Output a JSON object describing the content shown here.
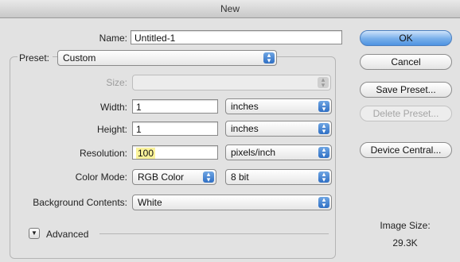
{
  "dialog": {
    "title": "New"
  },
  "form": {
    "name_label": "Name:",
    "name_value": "Untitled-1",
    "preset_label": "Preset:",
    "preset_value": "Custom",
    "size_label": "Size:",
    "size_value": "",
    "width_label": "Width:",
    "width_value": "1",
    "width_unit": "inches",
    "height_label": "Height:",
    "height_value": "1",
    "height_unit": "inches",
    "resolution_label": "Resolution:",
    "resolution_value": "100",
    "resolution_unit": "pixels/inch",
    "color_mode_label": "Color Mode:",
    "color_mode_value": "RGB Color",
    "bit_depth_value": "8 bit",
    "background_label": "Background Contents:",
    "background_value": "White",
    "advanced_label": "Advanced"
  },
  "buttons": {
    "ok": "OK",
    "cancel": "Cancel",
    "save_preset": "Save Preset...",
    "delete_preset": "Delete Preset...",
    "device_central": "Device Central..."
  },
  "image_size": {
    "label": "Image Size:",
    "value": "29.3K"
  },
  "colors": {
    "accent": "#4e93e2",
    "highlight": "#fbf39a",
    "background": "#e2e2e2"
  },
  "icons": {
    "popup_stepper": "updown-arrows-icon",
    "disclosure": "triangle-down-icon"
  }
}
